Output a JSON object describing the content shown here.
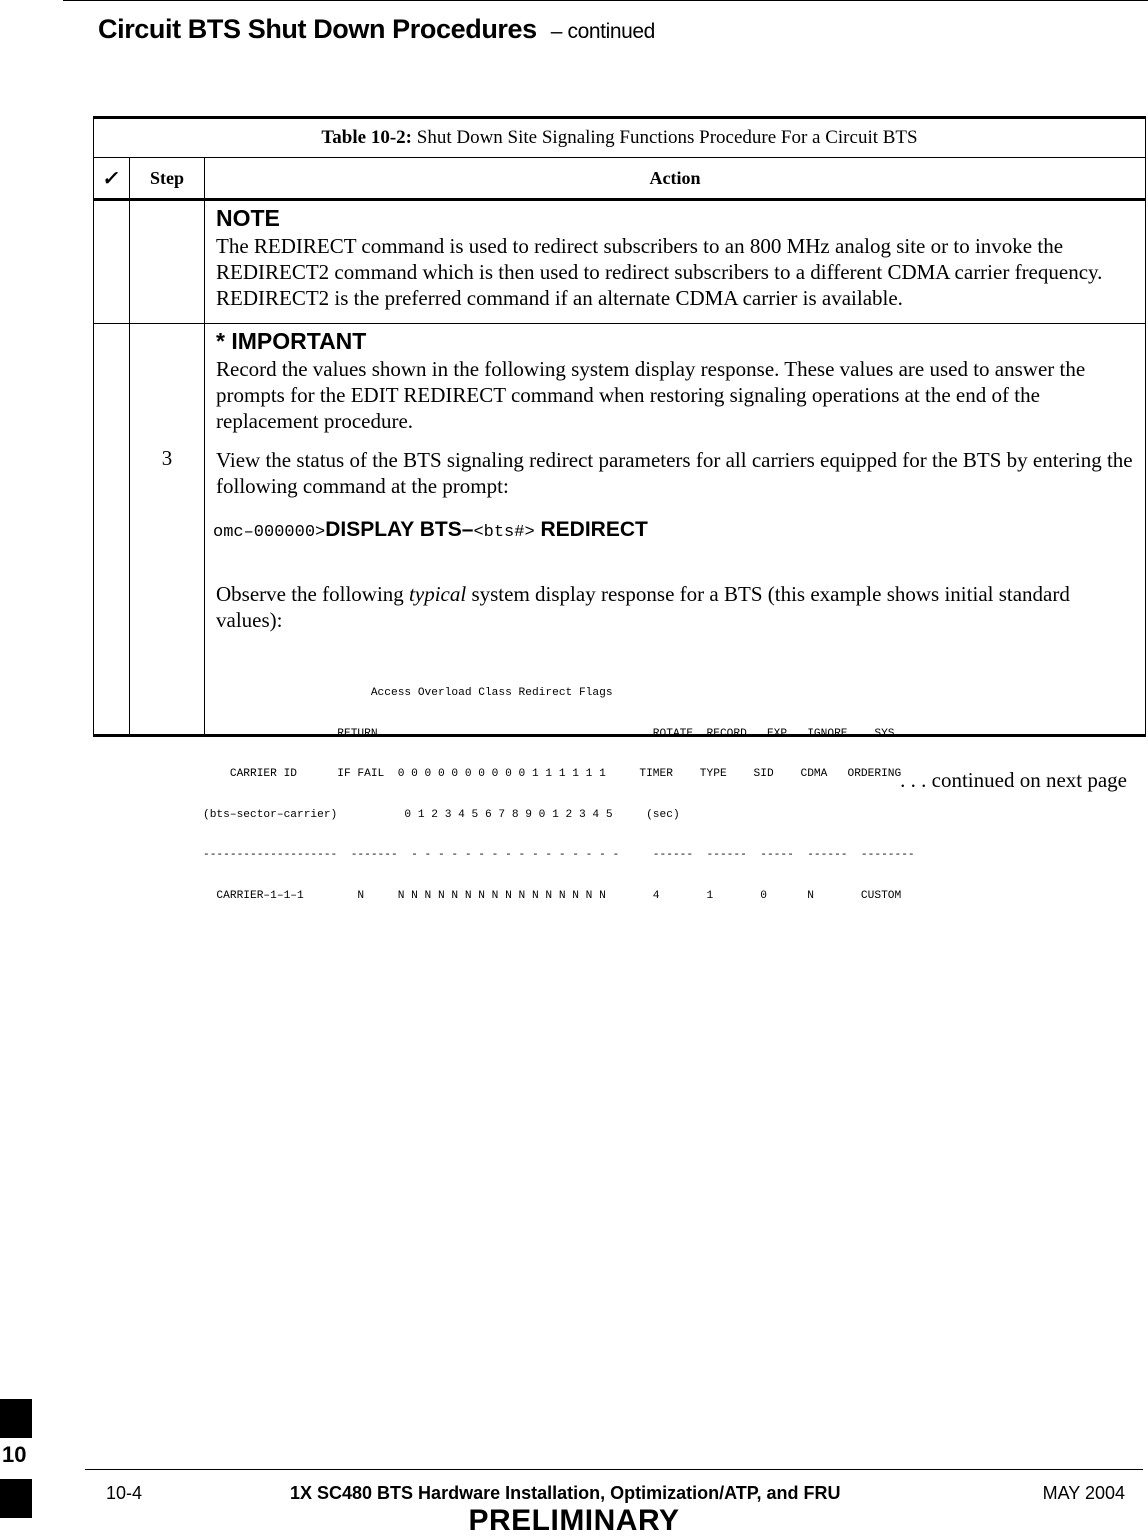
{
  "header": {
    "title": "Circuit BTS Shut Down Procedures",
    "continued": "– continued"
  },
  "table": {
    "caption_label": "Table 10-2:",
    "caption_text": " Shut Down Site Signaling Functions Procedure For a Circuit BTS",
    "columns": {
      "check_icon": "check-mark-icon",
      "check_glyph": "✓",
      "step": "Step",
      "action": "Action"
    },
    "note": {
      "heading": "NOTE",
      "text": "The REDIRECT command is used to redirect subscribers to an 800 MHz analog site or to invoke the REDIRECT2 command which is then used to redirect subscribers to a different CDMA carrier frequency. REDIRECT2 is the preferred command if an alternate CDMA carrier is available."
    },
    "step3": {
      "step_number": "3",
      "important_heading": "* IMPORTANT",
      "important_text": "Record the values shown in the following system display response. These values are used to answer the prompts for the EDIT REDIRECT command when restoring signaling operations at the end of the replacement procedure.",
      "view_text": "View the status of the BTS signaling redirect parameters for all carriers equipped for the BTS by entering the following command at the prompt:",
      "command": {
        "prompt": "omc–000000>",
        "cmd1": "DISPLAY BTS–",
        "arg": "<bts#>",
        "cmd2": " REDIRECT"
      },
      "observe_before": "Observe the following ",
      "observe_italic": "typical",
      "observe_after": " system display response for a BTS (this example shows initial standard values):",
      "display_lines": [
        "                         Access Overload Class Redirect Flags",
        "                    RETURN                                         ROTATE  RECORD   EXP   IGNORE    SYS",
        "    CARRIER ID      IF FAIL  0 0 0 0 0 0 0 0 0 0 1 1 1 1 1 1     TIMER    TYPE    SID    CDMA   ORDERING",
        "(bts–sector–carrier)          0 1 2 3 4 5 6 7 8 9 0 1 2 3 4 5     (sec)",
        "--------------------  -------  - - - - - - - - - - - - - - - -     ------  ------  -----  ------  --------",
        "  CARRIER–1–1–1        N     N N N N N N N N N N N N N N N N       4       1       0      N       CUSTOM"
      ]
    }
  },
  "continued_note": ". . . continued on next page",
  "side_tab": {
    "chapter": "10"
  },
  "footer": {
    "page_number": "10-4",
    "book_title": "1X SC480 BTS Hardware Installation, Optimization/ATP, and FRU",
    "date": "MAY 2004",
    "status": "PRELIMINARY"
  }
}
